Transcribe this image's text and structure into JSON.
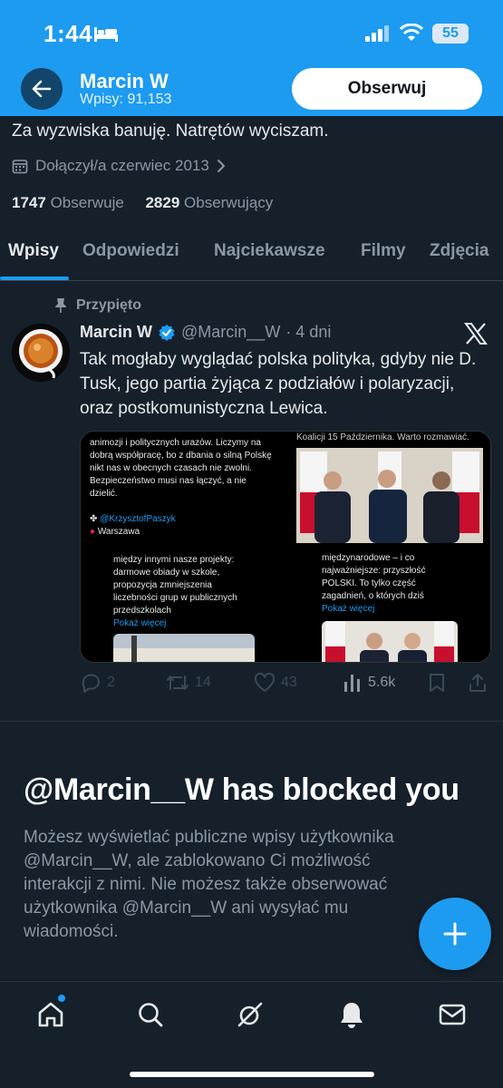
{
  "status_bar": {
    "time": "1:44",
    "battery": "55"
  },
  "header": {
    "name": "Marcin W",
    "posts": "Wpisy: 91,153",
    "follow_label": "Obserwuj"
  },
  "profile": {
    "bio": "Za wyzwiska banuję. Natrętów wyciszam.",
    "joined": "Dołączył/a czerwiec 2013",
    "following_count": "1747",
    "following_label": "Obserwuje",
    "followers_count": "2829",
    "followers_label": "Obserwujący"
  },
  "tabs": [
    {
      "label": "Wpisy",
      "active": true
    },
    {
      "label": "Odpowiedzi",
      "active": false
    },
    {
      "label": "Najciekawsze",
      "active": false
    },
    {
      "label": "Filmy",
      "active": false
    },
    {
      "label": "Zdjęcia",
      "active": false
    }
  ],
  "tweet": {
    "pinned_label": "Przypięto",
    "author": "Marcin W",
    "handle": "@Marcin__W",
    "time": "· 4 dni",
    "text": "Tak mogłaby wyglądać polska polityka, gdyby nie D. Tusk, jego partia żyjąca z podziałów i polaryzacji, oraz postkomunistyczna Lewica.",
    "media": {
      "c1_text": "animozji i politycznych urazów. Liczymy na dobrą współpracę, bo z dbania o silną Polskę nikt nas w obecnych czasach nie zwolni. Bezpieczeństwo musi nas łączyć, a nie dzielić.",
      "c1_link": "@KrzysztofPaszyk",
      "c1_place": "Warszawa",
      "c2_top": "Koalicji 15 Października. Warto rozmawiać.",
      "c3_text": "między innymi nasze projekty: darmowe obiady w szkole, propozycja zmniejszenia liczebności grup w publicznych przedszkolach",
      "c3_more": "Pokaż więcej",
      "c4_text": "międzynarodowe – i co najważniejsze: przyszłość POLSKI. To tylko część zagadnień, o których dziś",
      "c4_more": "Pokaż więcej"
    },
    "replies": "2",
    "reposts": "14",
    "likes": "43",
    "views": "5.6k"
  },
  "blocked": {
    "title": "@Marcin__W has blocked you",
    "text": "Możesz wyświetlać publiczne wpisy użytkownika @Marcin__W, ale zablokowano Ci możliwość interakcji z nimi. Nie możesz także obserwować użytkownika @Marcin__W ani wysyłać mu wiadomości."
  },
  "colors": {
    "accent": "#1d9bf0",
    "background": "#15202b",
    "text": "#e7e9ea",
    "muted": "#8b98a5"
  },
  "icons": [
    "back-arrow-icon",
    "calendar-icon",
    "chevron-right-icon",
    "pin-icon",
    "verified-icon",
    "x-logo-icon",
    "reply-icon",
    "repost-icon",
    "like-icon",
    "views-icon",
    "bookmark-icon",
    "share-icon",
    "compose-icon",
    "home-icon",
    "search-icon",
    "grok-icon",
    "notifications-icon",
    "messages-icon"
  ]
}
